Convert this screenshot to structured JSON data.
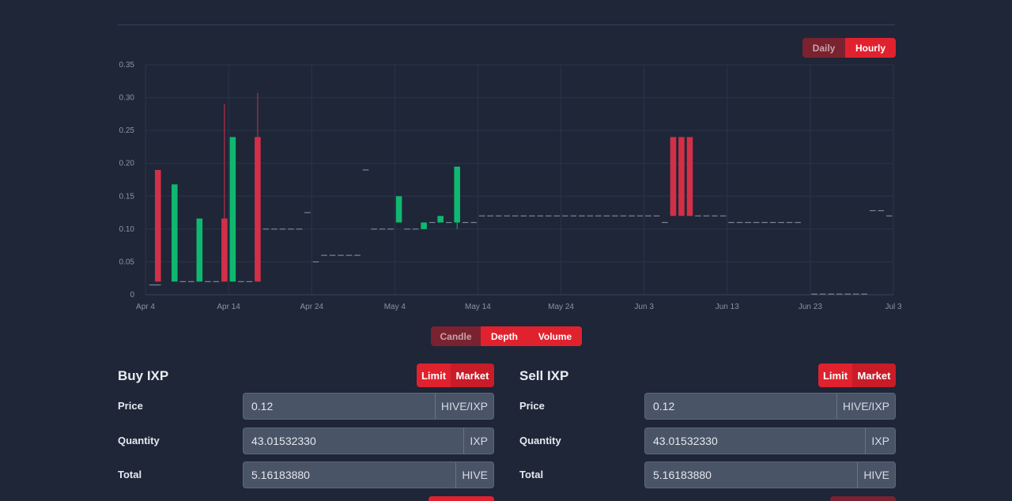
{
  "range_toggle": {
    "daily": "Daily",
    "hourly": "Hourly"
  },
  "chart_toggle": {
    "candle": "Candle",
    "depth": "Depth",
    "volume": "Volume"
  },
  "colors": {
    "up": "#10b86f",
    "down": "#d23048",
    "flat": "#7d8594",
    "accent": "#e0222e"
  },
  "chart_data": {
    "type": "candlestick",
    "ylim": [
      0,
      0.35
    ],
    "y_ticks": [
      "0",
      "0.05",
      "0.10",
      "0.15",
      "0.20",
      "0.25",
      "0.30",
      "0.35"
    ],
    "x_ticks": [
      "Apr 4",
      "Apr 14",
      "Apr 24",
      "May 4",
      "May 14",
      "May 24",
      "Jun 3",
      "Jun 13",
      "Jun 23",
      "Jul 3"
    ],
    "grid": true,
    "candles": [
      {
        "day": 0.3,
        "o": 0.015,
        "c": 0.015,
        "h": 0.015,
        "l": 0.015
      },
      {
        "day": 1.0,
        "o": 0.015,
        "c": 0.015,
        "h": 0.015,
        "l": 0.015
      },
      {
        "day": 1.0,
        "o": 0.19,
        "c": 0.02,
        "h": 0.19,
        "l": 0.02
      },
      {
        "day": 3.0,
        "o": 0.02,
        "c": 0.168,
        "h": 0.168,
        "l": 0.02
      },
      {
        "day": 4.0,
        "o": 0.02,
        "c": 0.02,
        "h": 0.02,
        "l": 0.02
      },
      {
        "day": 5.0,
        "o": 0.02,
        "c": 0.02,
        "h": 0.02,
        "l": 0.02
      },
      {
        "day": 6.0,
        "o": 0.02,
        "c": 0.116,
        "h": 0.116,
        "l": 0.02
      },
      {
        "day": 7.0,
        "o": 0.02,
        "c": 0.02,
        "h": 0.02,
        "l": 0.02
      },
      {
        "day": 8.0,
        "o": 0.02,
        "c": 0.02,
        "h": 0.02,
        "l": 0.02
      },
      {
        "day": 9.0,
        "o": 0.116,
        "c": 0.02,
        "h": 0.29,
        "l": 0.02
      },
      {
        "day": 10.0,
        "o": 0.02,
        "c": 0.24,
        "h": 0.24,
        "l": 0.02
      },
      {
        "day": 11.0,
        "o": 0.02,
        "c": 0.02,
        "h": 0.02,
        "l": 0.02
      },
      {
        "day": 12.0,
        "o": 0.02,
        "c": 0.02,
        "h": 0.02,
        "l": 0.02
      },
      {
        "day": 13.0,
        "o": 0.24,
        "c": 0.02,
        "h": 0.307,
        "l": 0.02
      },
      {
        "day": 14.0,
        "o": 0.1,
        "c": 0.1,
        "h": 0.1,
        "l": 0.1
      },
      {
        "day": 15.0,
        "o": 0.1,
        "c": 0.1,
        "h": 0.1,
        "l": 0.1
      },
      {
        "day": 16.0,
        "o": 0.1,
        "c": 0.1,
        "h": 0.1,
        "l": 0.1
      },
      {
        "day": 17.0,
        "o": 0.1,
        "c": 0.1,
        "h": 0.1,
        "l": 0.1
      },
      {
        "day": 18.0,
        "o": 0.1,
        "c": 0.1,
        "h": 0.1,
        "l": 0.1
      },
      {
        "day": 19.0,
        "o": 0.125,
        "c": 0.125,
        "h": 0.125,
        "l": 0.125
      },
      {
        "day": 20.0,
        "o": 0.05,
        "c": 0.05,
        "h": 0.05,
        "l": 0.05
      },
      {
        "day": 21.0,
        "o": 0.06,
        "c": 0.06,
        "h": 0.06,
        "l": 0.06
      },
      {
        "day": 22.0,
        "o": 0.06,
        "c": 0.06,
        "h": 0.06,
        "l": 0.06
      },
      {
        "day": 23.0,
        "o": 0.06,
        "c": 0.06,
        "h": 0.06,
        "l": 0.06
      },
      {
        "day": 24.0,
        "o": 0.06,
        "c": 0.06,
        "h": 0.06,
        "l": 0.06
      },
      {
        "day": 25.0,
        "o": 0.06,
        "c": 0.06,
        "h": 0.06,
        "l": 0.06
      },
      {
        "day": 26.0,
        "o": 0.19,
        "c": 0.19,
        "h": 0.19,
        "l": 0.19
      },
      {
        "day": 27.0,
        "o": 0.1,
        "c": 0.1,
        "h": 0.1,
        "l": 0.1
      },
      {
        "day": 28.0,
        "o": 0.1,
        "c": 0.1,
        "h": 0.1,
        "l": 0.1
      },
      {
        "day": 29.0,
        "o": 0.1,
        "c": 0.1,
        "h": 0.1,
        "l": 0.1
      },
      {
        "day": 30.0,
        "o": 0.11,
        "c": 0.15,
        "h": 0.15,
        "l": 0.11
      },
      {
        "day": 31.0,
        "o": 0.1,
        "c": 0.1,
        "h": 0.1,
        "l": 0.1
      },
      {
        "day": 32.0,
        "o": 0.1,
        "c": 0.1,
        "h": 0.1,
        "l": 0.1
      },
      {
        "day": 33.0,
        "o": 0.1,
        "c": 0.11,
        "h": 0.11,
        "l": 0.1
      },
      {
        "day": 34.0,
        "o": 0.11,
        "c": 0.11,
        "h": 0.11,
        "l": 0.11
      },
      {
        "day": 35.0,
        "o": 0.11,
        "c": 0.12,
        "h": 0.12,
        "l": 0.11
      },
      {
        "day": 36.0,
        "o": 0.11,
        "c": 0.11,
        "h": 0.11,
        "l": 0.11
      },
      {
        "day": 37.0,
        "o": 0.11,
        "c": 0.195,
        "h": 0.195,
        "l": 0.1
      },
      {
        "day": 38.0,
        "o": 0.11,
        "c": 0.11,
        "h": 0.11,
        "l": 0.11
      },
      {
        "day": 39.0,
        "o": 0.11,
        "c": 0.11,
        "h": 0.11,
        "l": 0.11
      },
      {
        "day": 40.0,
        "o": 0.12,
        "c": 0.12,
        "h": 0.12,
        "l": 0.12
      },
      {
        "day": 41.0,
        "o": 0.12,
        "c": 0.12,
        "h": 0.12,
        "l": 0.12
      },
      {
        "day": 42.0,
        "o": 0.12,
        "c": 0.12,
        "h": 0.12,
        "l": 0.12
      },
      {
        "day": 43.0,
        "o": 0.12,
        "c": 0.12,
        "h": 0.12,
        "l": 0.12
      },
      {
        "day": 44.0,
        "o": 0.12,
        "c": 0.12,
        "h": 0.12,
        "l": 0.12
      },
      {
        "day": 45.0,
        "o": 0.12,
        "c": 0.12,
        "h": 0.12,
        "l": 0.12
      },
      {
        "day": 46.0,
        "o": 0.12,
        "c": 0.12,
        "h": 0.12,
        "l": 0.12
      },
      {
        "day": 47.0,
        "o": 0.12,
        "c": 0.12,
        "h": 0.12,
        "l": 0.12
      },
      {
        "day": 48.0,
        "o": 0.12,
        "c": 0.12,
        "h": 0.12,
        "l": 0.12
      },
      {
        "day": 49.0,
        "o": 0.12,
        "c": 0.12,
        "h": 0.12,
        "l": 0.12
      },
      {
        "day": 50.0,
        "o": 0.12,
        "c": 0.12,
        "h": 0.12,
        "l": 0.12
      },
      {
        "day": 51.0,
        "o": 0.12,
        "c": 0.12,
        "h": 0.12,
        "l": 0.12
      },
      {
        "day": 52.0,
        "o": 0.12,
        "c": 0.12,
        "h": 0.12,
        "l": 0.12
      },
      {
        "day": 53.0,
        "o": 0.12,
        "c": 0.12,
        "h": 0.12,
        "l": 0.12
      },
      {
        "day": 54.0,
        "o": 0.12,
        "c": 0.12,
        "h": 0.12,
        "l": 0.12
      },
      {
        "day": 55.0,
        "o": 0.12,
        "c": 0.12,
        "h": 0.12,
        "l": 0.12
      },
      {
        "day": 56.0,
        "o": 0.12,
        "c": 0.12,
        "h": 0.12,
        "l": 0.12
      },
      {
        "day": 57.0,
        "o": 0.12,
        "c": 0.12,
        "h": 0.12,
        "l": 0.12
      },
      {
        "day": 58.0,
        "o": 0.12,
        "c": 0.12,
        "h": 0.12,
        "l": 0.12
      },
      {
        "day": 59.0,
        "o": 0.12,
        "c": 0.12,
        "h": 0.12,
        "l": 0.12
      },
      {
        "day": 60.0,
        "o": 0.12,
        "c": 0.12,
        "h": 0.12,
        "l": 0.12
      },
      {
        "day": 61.0,
        "o": 0.12,
        "c": 0.12,
        "h": 0.12,
        "l": 0.12
      },
      {
        "day": 62.0,
        "o": 0.11,
        "c": 0.11,
        "h": 0.11,
        "l": 0.11
      },
      {
        "day": 63.0,
        "o": 0.24,
        "c": 0.12,
        "h": 0.24,
        "l": 0.12
      },
      {
        "day": 64.0,
        "o": 0.24,
        "c": 0.12,
        "h": 0.24,
        "l": 0.12
      },
      {
        "day": 65.0,
        "o": 0.24,
        "c": 0.12,
        "h": 0.24,
        "l": 0.12
      },
      {
        "day": 66.0,
        "o": 0.12,
        "c": 0.12,
        "h": 0.12,
        "l": 0.12
      },
      {
        "day": 67.0,
        "o": 0.12,
        "c": 0.12,
        "h": 0.12,
        "l": 0.12
      },
      {
        "day": 68.0,
        "o": 0.12,
        "c": 0.12,
        "h": 0.12,
        "l": 0.12
      },
      {
        "day": 69.0,
        "o": 0.12,
        "c": 0.12,
        "h": 0.12,
        "l": 0.12
      },
      {
        "day": 70.0,
        "o": 0.11,
        "c": 0.11,
        "h": 0.11,
        "l": 0.11
      },
      {
        "day": 71.0,
        "o": 0.11,
        "c": 0.11,
        "h": 0.11,
        "l": 0.11
      },
      {
        "day": 72.0,
        "o": 0.11,
        "c": 0.11,
        "h": 0.11,
        "l": 0.11
      },
      {
        "day": 73.0,
        "o": 0.11,
        "c": 0.11,
        "h": 0.11,
        "l": 0.11
      },
      {
        "day": 74.0,
        "o": 0.11,
        "c": 0.11,
        "h": 0.11,
        "l": 0.11
      },
      {
        "day": 75.0,
        "o": 0.11,
        "c": 0.11,
        "h": 0.11,
        "l": 0.11
      },
      {
        "day": 76.0,
        "o": 0.11,
        "c": 0.11,
        "h": 0.11,
        "l": 0.11
      },
      {
        "day": 77.0,
        "o": 0.11,
        "c": 0.11,
        "h": 0.11,
        "l": 0.11
      },
      {
        "day": 78.0,
        "o": 0.11,
        "c": 0.11,
        "h": 0.11,
        "l": 0.11
      },
      {
        "day": 80.0,
        "o": 0.001,
        "c": 0.001,
        "h": 0.001,
        "l": 0.001
      },
      {
        "day": 81.0,
        "o": 0.001,
        "c": 0.001,
        "h": 0.001,
        "l": 0.001
      },
      {
        "day": 82.0,
        "o": 0.001,
        "c": 0.001,
        "h": 0.001,
        "l": 0.001
      },
      {
        "day": 83.0,
        "o": 0.001,
        "c": 0.001,
        "h": 0.001,
        "l": 0.001
      },
      {
        "day": 84.0,
        "o": 0.001,
        "c": 0.001,
        "h": 0.001,
        "l": 0.001
      },
      {
        "day": 85.0,
        "o": 0.001,
        "c": 0.001,
        "h": 0.001,
        "l": 0.001
      },
      {
        "day": 86.0,
        "o": 0.001,
        "c": 0.001,
        "h": 0.001,
        "l": 0.001
      },
      {
        "day": 87.0,
        "o": 0.128,
        "c": 0.128,
        "h": 0.128,
        "l": 0.128
      },
      {
        "day": 88.0,
        "o": 0.128,
        "c": 0.128,
        "h": 0.128,
        "l": 0.128
      },
      {
        "day": 89.0,
        "o": 0.12,
        "c": 0.12,
        "h": 0.12,
        "l": 0.12
      }
    ]
  },
  "buy": {
    "title": "Buy IXP",
    "limit": "Limit",
    "market": "Market",
    "price_label": "Price",
    "price_value": "0.12",
    "price_unit": "HIVE/IXP",
    "quantity_label": "Quantity",
    "quantity_value": "43.01532330",
    "quantity_unit": "IXP",
    "total_label": "Total",
    "total_value": "5.16183880",
    "total_unit": "HIVE"
  },
  "sell": {
    "title": "Sell IXP",
    "limit": "Limit",
    "market": "Market",
    "price_label": "Price",
    "price_value": "0.12",
    "price_unit": "HIVE/IXP",
    "quantity_label": "Quantity",
    "quantity_value": "43.01532330",
    "quantity_unit": "IXP",
    "total_label": "Total",
    "total_value": "5.16183880",
    "total_unit": "HIVE"
  }
}
